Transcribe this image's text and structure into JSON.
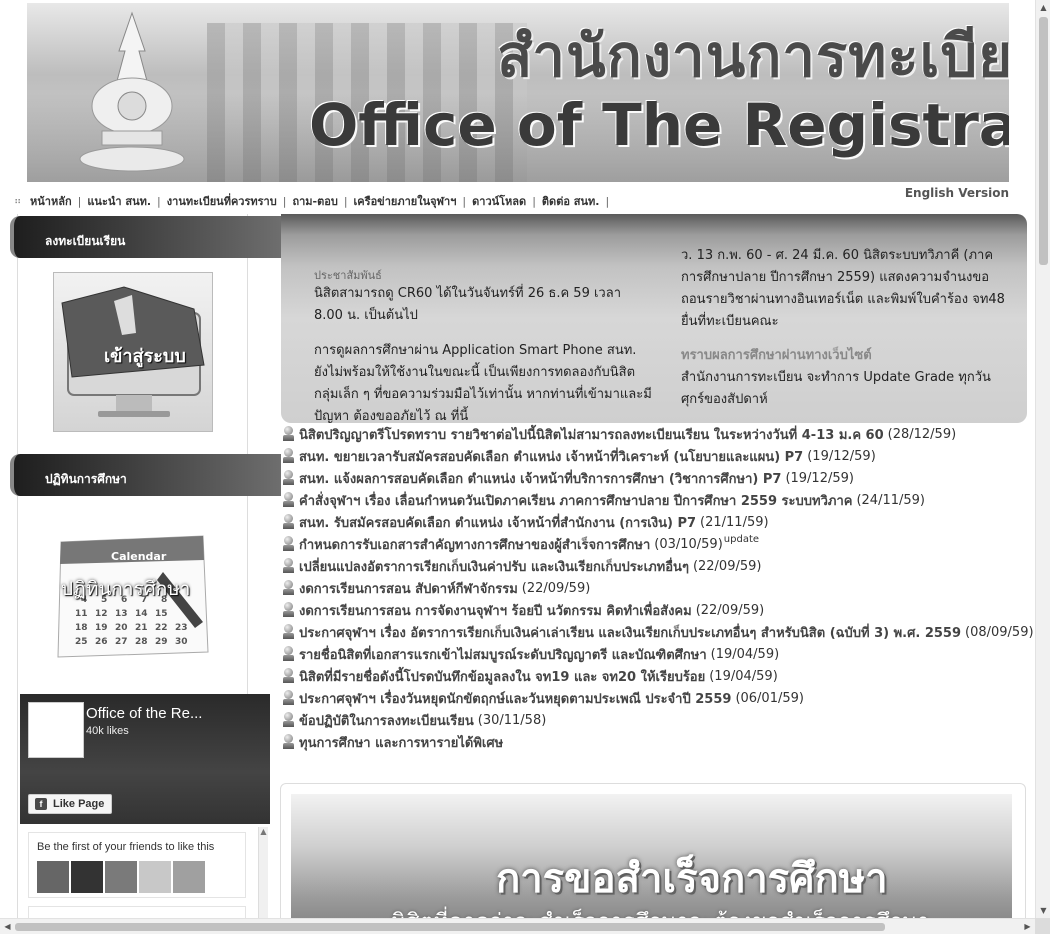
{
  "banner": {
    "title_thai": "สำนักงานการทะเบียน",
    "title_eng": "Office of The Registrar"
  },
  "nav": {
    "items": [
      {
        "label": "หน้าหลัก"
      },
      {
        "label": "แนะนำ สนท."
      },
      {
        "label": "งานทะเบียนที่ควรทราบ"
      },
      {
        "label": "ถาม-ตอบ"
      },
      {
        "label": "เครือข่ายภายในจุฬาฯ"
      },
      {
        "label": "ดาวน์โหลด"
      },
      {
        "label": "ติดต่อ สนท."
      }
    ],
    "separator": "|",
    "english_version": "English Version"
  },
  "sidebar": {
    "register_heading": "ลงทะเบียนเรียน",
    "login_label": "เข้าสู่ระบบ",
    "calendar_heading": "ปฏิทินการศึกษา",
    "calendar_word": "Calendar",
    "calendar_label": "ปฏิทินการศึกษา"
  },
  "facebook": {
    "page_name": "Office of the Re...",
    "likes": "40k likes",
    "like_button": "Like Page",
    "friends_text": "Be the first of your friends to like this"
  },
  "news_panel": {
    "pr_label": "ประชาสัมพันธ์",
    "pr_items": [
      "นิสิตสามารถดู CR60 ได้ในวันจันทร์ที่ 26 ธ.ค 59 เวลา 8.00 น. เป็นต้นไป",
      "การดูผลการศึกษาผ่าน Application Smart Phone สนท. ยังไม่พร้อมให้ใช้งานในขณะนี้ เป็นเพียงการทดลองกับนิสิตกลุ่มเล็ก ๆ ที่ขอความร่วมมือไว้เท่านั้น หากท่านที่เข้ามาและมีปัญหา ต้องขออภัยไว้ ณ ที่นี้"
    ],
    "right_text": "ว. 13 ก.พ. 60 - ศ. 24 มี.ค. 60 นิสิตระบบทวิภาคี (ภาคการศึกษาปลาย ปีการศึกษา 2559) แสดงความจำนงขอถอนรายวิชาผ่านทางอินเทอร์เน็ต และพิมพ์ใบคำร้อง จท48 ยื่นที่ทะเบียนคณะ",
    "right_heading": "ทราบผลการศึกษาผ่านทางเว็บไซต์",
    "right_text2": "สำนักงานการทะเบียน จะทำการ Update Grade ทุกวันศุกร์ของสัปดาห์"
  },
  "news_list": [
    {
      "title": "นิสิตปริญญาตรีโปรดทราบ รายวิชาต่อไปนี้นิสิตไม่สามารถลงทะเบียนเรียน ในระหว่างวันที่ 4-13 ม.ค 60",
      "date": "(28/12/59)",
      "badge": ""
    },
    {
      "title": "สนท. ขยายเวลารับสมัครสอบคัดเลือก ตำแหน่ง เจ้าหน้าที่วิเคราะห์ (นโยบายและแผน) P7",
      "date": "(19/12/59)",
      "badge": ""
    },
    {
      "title": "สนท. แจ้งผลการสอบคัดเลือก ตำแหน่ง เจ้าหน้าที่บริการการศึกษา (วิชาการศึกษา) P7",
      "date": "(19/12/59)",
      "badge": ""
    },
    {
      "title": "คำสั่งจุฬาฯ เรื่อง เลื่อนกำหนดวันเปิดภาคเรียน ภาคการศึกษาปลาย ปีการศึกษา 2559 ระบบทวิภาค",
      "date": "(24/11/59)",
      "badge": ""
    },
    {
      "title": "สนท. รับสมัครสอบคัดเลือก ตำแหน่ง เจ้าหน้าที่สำนักงาน (การเงิน) P7",
      "date": "(21/11/59)",
      "badge": ""
    },
    {
      "title": "กำหนดการรับเอกสารสำคัญทางการศึกษาของผู้สำเร็จการศึกษา",
      "date": "(03/10/59)",
      "badge": "update"
    },
    {
      "title": "เปลี่ยนแปลงอัตราการเรียกเก็บเงินค่าปรับ และเงินเรียกเก็บประเภทอื่นๆ",
      "date": "(22/09/59)",
      "badge": ""
    },
    {
      "title": "งดการเรียนการสอน สัปดาห์กีฬาจักรรม",
      "date": "(22/09/59)",
      "badge": ""
    },
    {
      "title": "งดการเรียนการสอน การจัดงานจุฬาฯ ร้อยปี นวัตกรรม คิดทำเพื่อสังคม",
      "date": "(22/09/59)",
      "badge": ""
    },
    {
      "title": "ประกาศจุฬาฯ เรื่อง อัตราการเรียกเก็บเงินค่าเล่าเรียน และเงินเรียกเก็บประเภทอื่นๆ สำหรับนิสิต (ฉบับที่ 3) พ.ศ. 2559",
      "date": "(08/09/59)",
      "badge": ""
    },
    {
      "title": "รายชื่อนิสิตที่เอกสารแรกเข้าไม่สมบูรณ์ระดับปริญญาตรี และบัณฑิตศึกษา",
      "date": "(19/04/59)",
      "badge": ""
    },
    {
      "title": "นิสิตที่มีรายชื่อดังนี้โปรดบันทึกข้อมูลลงใน จท19 และ จท20 ให้เรียบร้อย",
      "date": "(19/04/59)",
      "badge": ""
    },
    {
      "title": "ประกาศจุฬาฯ เรื่องวันหยุดนักขัตฤกษ์และวันหยุดตามประเพณี ประจำปี 2559",
      "date": "(06/01/59)",
      "badge": ""
    },
    {
      "title": "ข้อปฏิบัติในการลงทะเบียนเรียน",
      "date": "(30/11/58)",
      "badge": ""
    },
    {
      "title": "ทุนการศึกษา และการหารายได้พิเศษ",
      "date": "",
      "badge": ""
    }
  ],
  "grad_panel": {
    "title": "การขอสำเร็จการศึกษา",
    "subtitle": "นิสิตที่คาดว่าจะสำเร็จการศึกษาจะต้องขอสำเร็จการศึกษา"
  },
  "colors": {
    "header_dark": "#2e2e2e",
    "news_title": "#444444",
    "panel_bg": "#d0d0d0"
  }
}
